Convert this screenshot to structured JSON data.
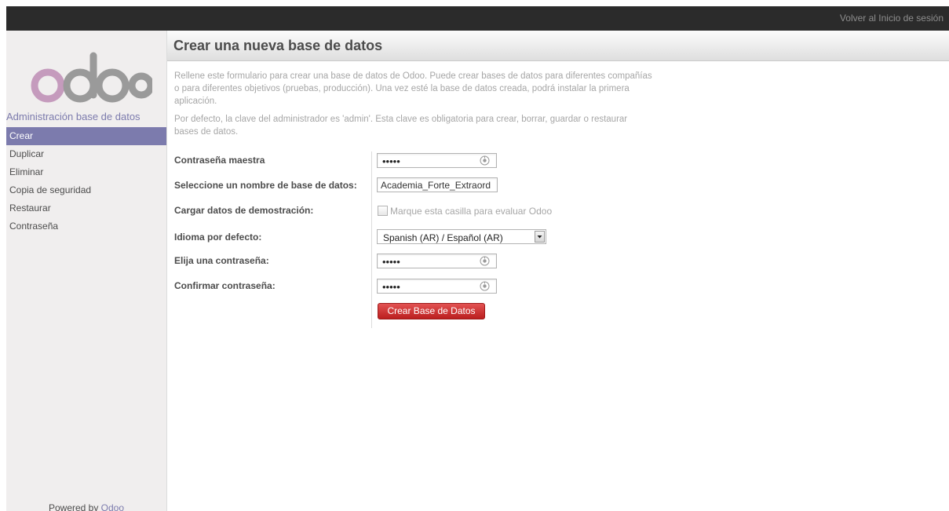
{
  "topbar": {
    "login_link": "Volver al Inicio de sesión"
  },
  "sidebar": {
    "logo_text": "odoo",
    "heading": "Administración base de datos",
    "items": [
      {
        "label": "Crear",
        "active": true
      },
      {
        "label": "Duplicar",
        "active": false
      },
      {
        "label": "Eliminar",
        "active": false
      },
      {
        "label": "Copia de seguridad",
        "active": false
      },
      {
        "label": "Restaurar",
        "active": false
      },
      {
        "label": "Contraseña",
        "active": false
      }
    ],
    "powered_prefix": "Powered by ",
    "powered_brand": "Odoo"
  },
  "main": {
    "title": "Crear una nueva base de datos",
    "intro_1": "Rellene este formulario para crear una base de datos de Odoo. Puede crear bases de datos para diferentes compañías o para diferentes objetivos (pruebas, producción). Una vez esté la base de datos creada, podrá instalar la primera aplicación.",
    "intro_2": "Por defecto, la clave del administrador es 'admin'. Esta clave es obligatoria para crear, borrar, guardar o restaurar bases de datos."
  },
  "form": {
    "master_password": {
      "label": "Contraseña maestra",
      "value": "•••••"
    },
    "db_name": {
      "label": "Seleccione un nombre de base de datos:",
      "value": "Academia_Forte_Extraord"
    },
    "demo_data": {
      "label": "Cargar datos de demostración:",
      "checkbox_text": "Marque esta casilla para evaluar Odoo",
      "checked": false
    },
    "language": {
      "label": "Idioma por defecto:",
      "value": "Spanish (AR) / Español (AR)"
    },
    "password": {
      "label": "Elija una contraseña:",
      "value": "•••••"
    },
    "confirm_password": {
      "label": "Confirmar contraseña:",
      "value": "•••••"
    },
    "submit_label": "Crear Base de Datos"
  },
  "colors": {
    "topbar": "#2b2b2b",
    "accent": "#7c7bad",
    "submit": "#c92a2a",
    "logo_pink": "#c59bbd",
    "logo_grey": "#9a9a9a"
  },
  "icons": {
    "password_toggle": "eye-icon",
    "select_arrow": "chevron-down-icon"
  }
}
